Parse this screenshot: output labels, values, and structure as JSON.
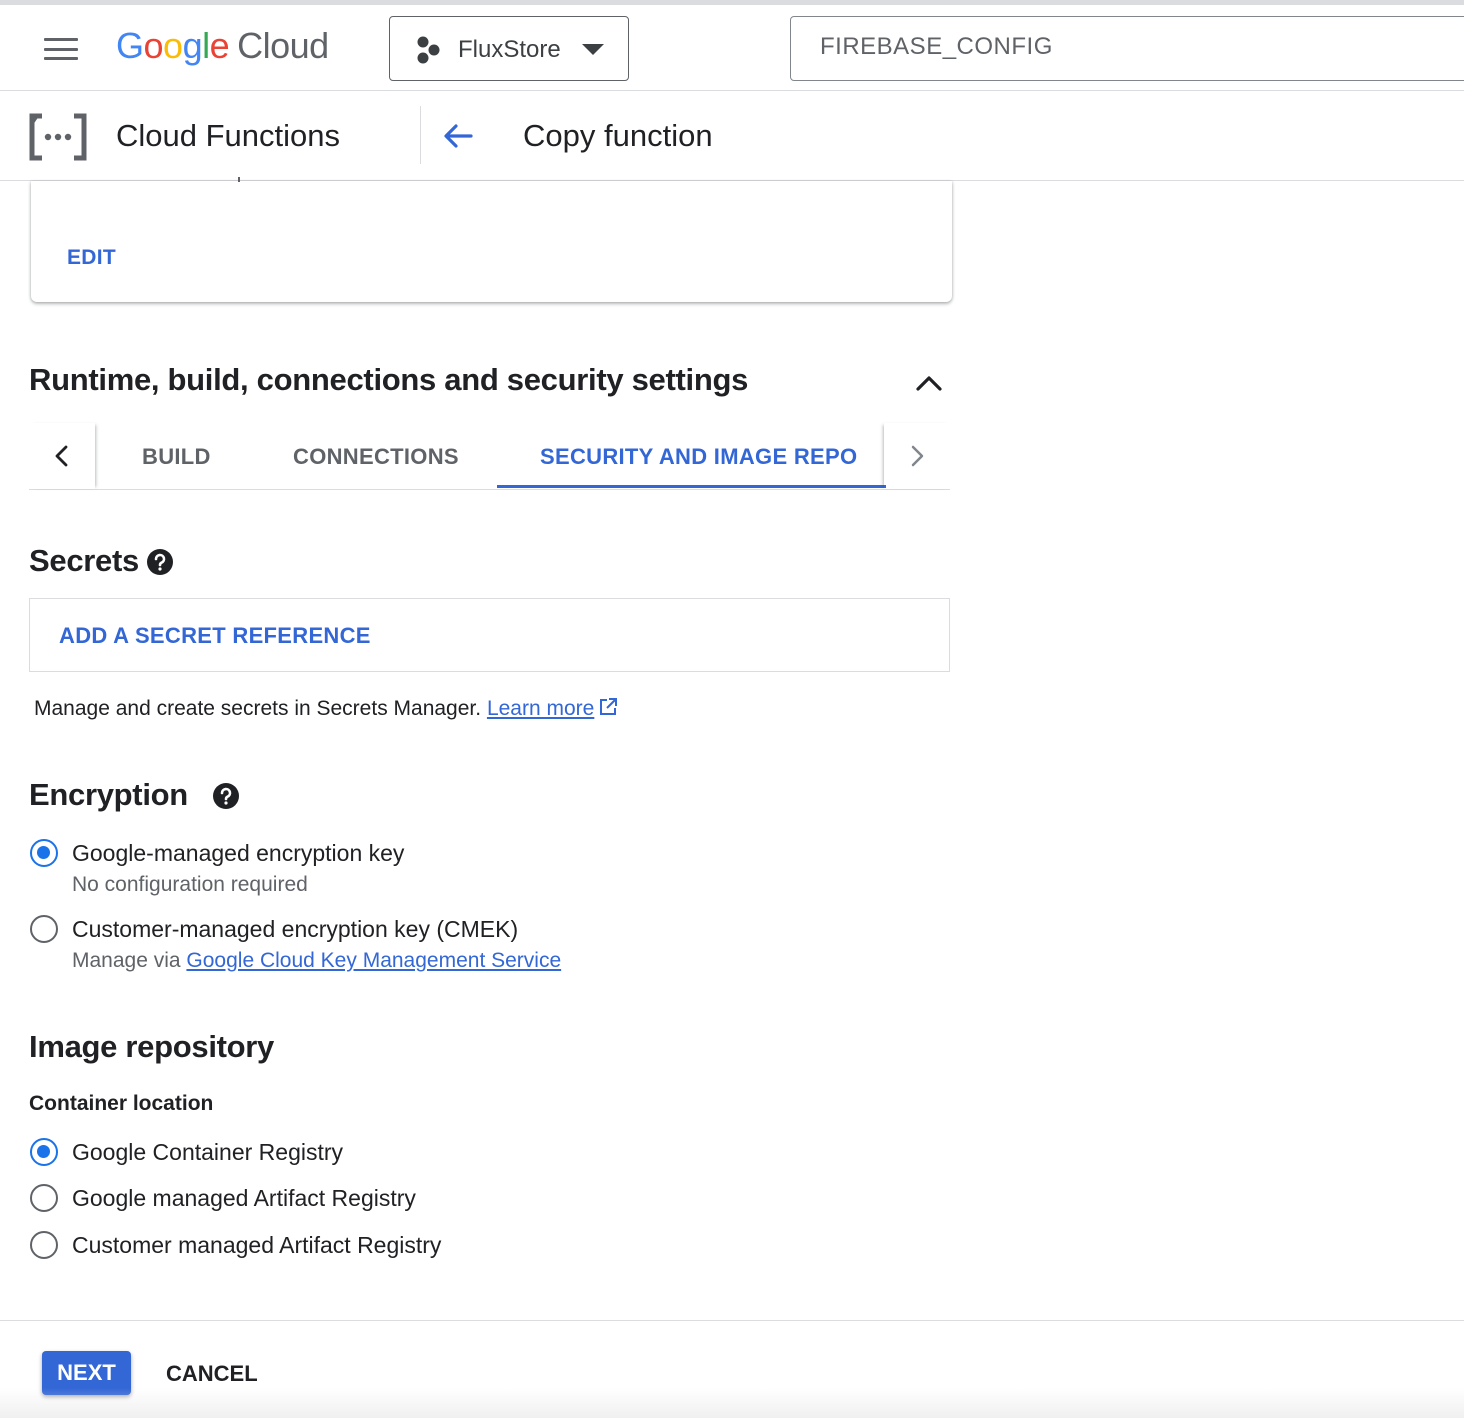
{
  "topbar": {
    "logo_letters": [
      "G",
      "o",
      "o",
      "g",
      "l",
      "e"
    ],
    "logo_cloud": "Cloud",
    "project_name": "FluxStore",
    "search_value": "FIREBASE_CONFIG"
  },
  "subheader": {
    "product": "Cloud Functions",
    "page_title": "Copy function"
  },
  "card": {
    "edit_label": "EDIT"
  },
  "section": {
    "title": "Runtime, build, connections and security settings",
    "tabs": [
      {
        "label": "BUILD",
        "active": false
      },
      {
        "label": "CONNECTIONS",
        "active": false
      },
      {
        "label": "SECURITY AND IMAGE REPO",
        "active": true
      }
    ]
  },
  "secrets": {
    "heading": "Secrets",
    "add_button": "ADD A SECRET REFERENCE",
    "helper_text": "Manage and create secrets in Secrets Manager.",
    "learn_more": "Learn more"
  },
  "encryption": {
    "heading": "Encryption",
    "options": [
      {
        "label": "Google-managed encryption key",
        "sub": "No configuration required",
        "selected": true
      },
      {
        "label": "Customer-managed encryption key (CMEK)",
        "sub_prefix": "Manage via",
        "sub_link": "Google Cloud Key Management Service",
        "selected": false
      }
    ]
  },
  "image_repository": {
    "heading": "Image repository",
    "container_location_label": "Container location",
    "options": [
      {
        "label": "Google Container Registry",
        "selected": true
      },
      {
        "label": "Google managed Artifact Registry",
        "selected": false
      },
      {
        "label": "Customer managed Artifact Registry",
        "selected": false
      }
    ]
  },
  "footer": {
    "next_label": "NEXT",
    "cancel_label": "CANCEL"
  },
  "colors": {
    "accent": "#3367d6",
    "radio_selected": "#1a73e8",
    "google_blue": "#4285f4",
    "google_red": "#ea4335",
    "google_yellow": "#fbbc05",
    "google_green": "#34a853"
  }
}
